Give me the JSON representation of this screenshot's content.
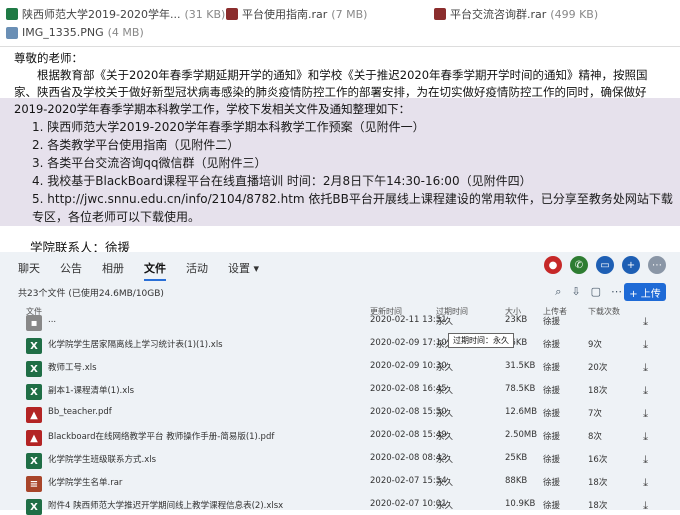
{
  "attachments": [
    {
      "name": "陕西师范大学2019-2020学年...",
      "size": "(31 KB)",
      "icon": "excel-icon",
      "color": "#1f7a45"
    },
    {
      "name": "平台使用指南.rar",
      "size": "(7 MB)",
      "icon": "archive-icon",
      "color": "#8b2d2d"
    },
    {
      "name": "平台交流咨询群.rar",
      "size": "(499 KB)",
      "icon": "archive-icon",
      "color": "#8b2d2d"
    },
    {
      "name": "IMG_1335.PNG",
      "size": "(4 MB)",
      "icon": "image-icon",
      "color": "#6a8fb5"
    }
  ],
  "email": {
    "greeting": "尊敬的老师：",
    "intro": "根据教育部《关于2020年春季学期延期开学的通知》和学校《关于推迟2020年春季学期开学时间的通知》精神，按照国家、陕西省及学校关于做好新型冠状病毒感染的肺炎疫情防控工作的部署安排，为在切实做好疫情防控工作的同时，确保做好2019-2020学年春季学期本科教学工作，学校下发相关文件及通知整理如下：",
    "items": [
      "1. 陕西师范大学2019-2020学年春季学期本科教学工作预案（见附件一）",
      "2. 各类教学平台使用指南（见附件二）",
      "3. 各类平台交流咨询qq微信群（见附件三）",
      "4. 我校基于BlackBoard课程平台在线直播培训 时间：2月8日下午14:30-16:00（见附件四）",
      "5. http://jwc.snnu.edu.cn/info/2104/8782.htm 依托BB平台开展线上课程建设的常用软件，已分享至教务处网站下载专区，各位老师可以下载使用。"
    ],
    "contact": "学院联系人：徐援"
  },
  "panel": {
    "tabs": [
      "聊天",
      "公告",
      "相册",
      "文件",
      "活动",
      "设置 ▾"
    ],
    "active_tab": "文件",
    "file_summary": "共23个文件 (已使用24.6MB/10GB)",
    "upload_label": "+ 上传",
    "columns": {
      "name": "文件",
      "time": "更新时间",
      "expire": "过期时间",
      "size": "大小",
      "uploader": "上传者",
      "downloads": "下载次数"
    },
    "tooltip": "过期时间：永久",
    "files": [
      {
        "name": "...",
        "time": "2020-02-11 13:51",
        "expire": "永久",
        "size": "23KB",
        "uploader": "徐援",
        "downloads": "",
        "type": "doc"
      },
      {
        "name": "化学院学生居家隔离线上学习统计表(1)(1).xls",
        "time": "2020-02-09 17:10",
        "expire": "永久",
        "size": "36KB",
        "uploader": "徐援",
        "downloads": "9次",
        "type": "xls"
      },
      {
        "name": "教师工号.xls",
        "time": "2020-02-09 10:30",
        "expire": "永久",
        "size": "31.5KB",
        "uploader": "徐援",
        "downloads": "20次",
        "type": "xls"
      },
      {
        "name": "副本1-课程清单(1).xls",
        "time": "2020-02-08 16:45",
        "expire": "永久",
        "size": "78.5KB",
        "uploader": "徐援",
        "downloads": "18次",
        "type": "xls"
      },
      {
        "name": "Bb_teacher.pdf",
        "time": "2020-02-08 15:50",
        "expire": "永久",
        "size": "12.6MB",
        "uploader": "徐援",
        "downloads": "7次",
        "type": "pdf"
      },
      {
        "name": "Blackboard在线网络教学平台 教师操作手册-简易版(1).pdf",
        "time": "2020-02-08 15:49",
        "expire": "永久",
        "size": "2.50MB",
        "uploader": "徐援",
        "downloads": "8次",
        "type": "pdf"
      },
      {
        "name": "化学院学生班级联系方式.xls",
        "time": "2020-02-08 08:43",
        "expire": "永久",
        "size": "25KB",
        "uploader": "徐援",
        "downloads": "16次",
        "type": "xls"
      },
      {
        "name": "化学院学生名单.rar",
        "time": "2020-02-07 15:54",
        "expire": "永久",
        "size": "88KB",
        "uploader": "徐援",
        "downloads": "18次",
        "type": "rar"
      },
      {
        "name": "附件4 陕西师范大学推迟开学期间线上教学课程信息表(2).xlsx",
        "time": "2020-02-07 10:01",
        "expire": "永久",
        "size": "10.9KB",
        "uploader": "徐援",
        "downloads": "18次",
        "type": "xls"
      }
    ]
  }
}
